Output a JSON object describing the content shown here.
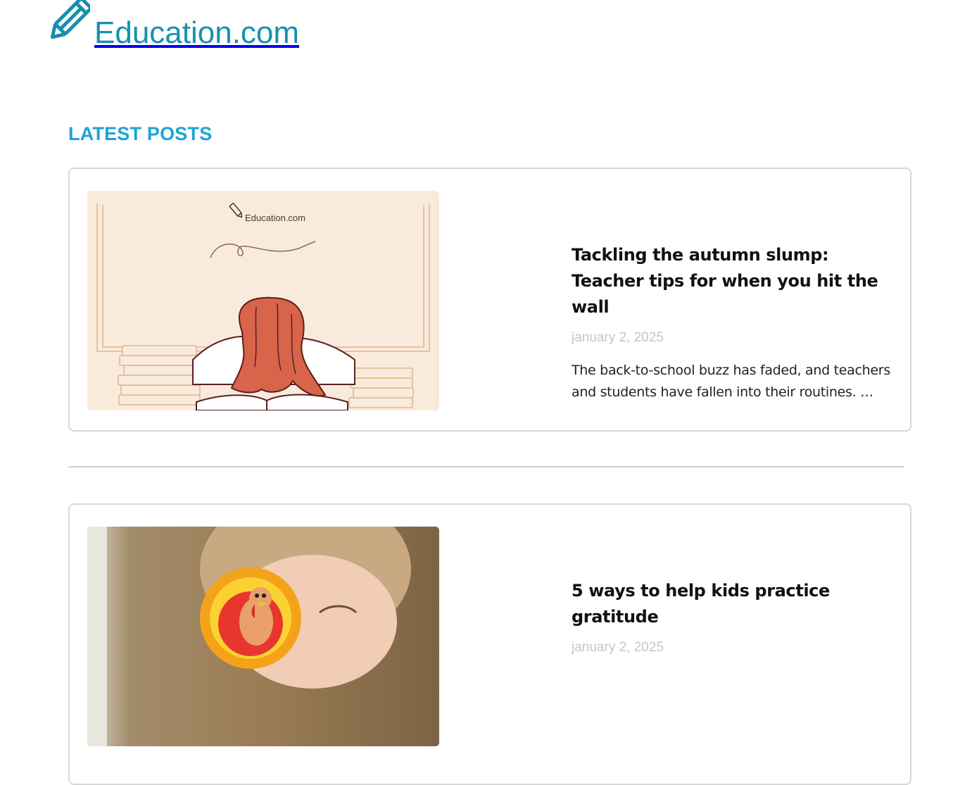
{
  "site": {
    "name": "Education.com",
    "logo_icon": "pencil-icon",
    "brand_color": "#1690b0"
  },
  "section": {
    "title": "LATEST POSTS",
    "title_color": "#1ea3d7"
  },
  "posts": [
    {
      "title": "Tackling the autumn slump: Teacher tips for when you hit the wall",
      "date": "january 2, 2025",
      "excerpt": "The back-to-school buzz has faded, and teachers and students have fallen into their routines. …",
      "image_logo_text": "Education.com"
    },
    {
      "title": "5 ways to help kids practice gratitude",
      "date": "january 2, 2025"
    }
  ]
}
